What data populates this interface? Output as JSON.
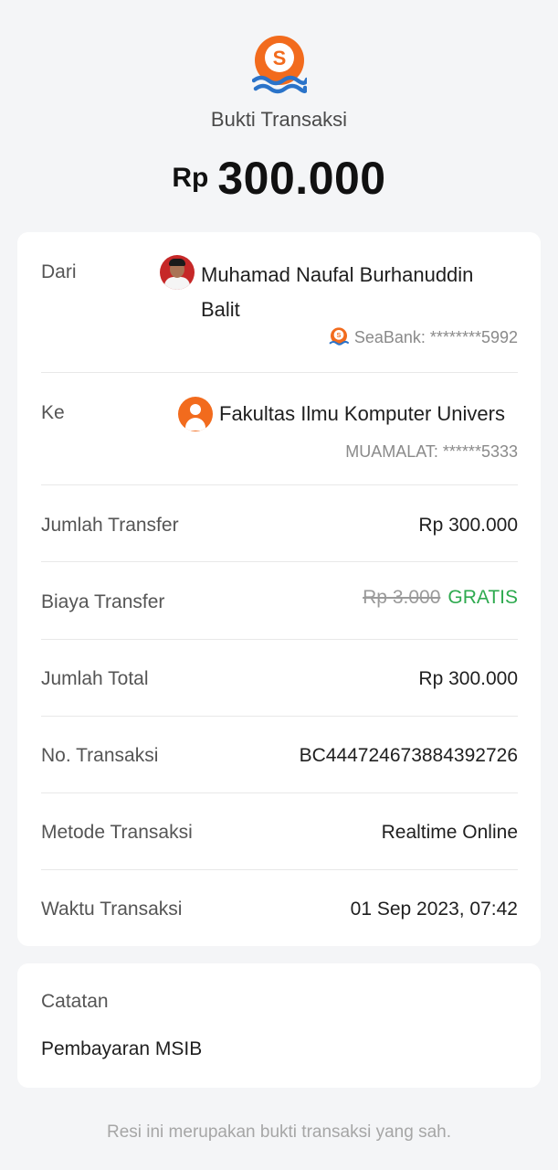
{
  "header": {
    "title": "Bukti Transaksi",
    "currency": "Rp",
    "amount": "300.000",
    "brand_color": "#f26b1d",
    "wave_color": "#2a73c9"
  },
  "sender": {
    "label": "Dari",
    "name": "Muhamad Naufal Burhanuddin Balit",
    "bank": "SeaBank: ********5992",
    "avatar_icon": "profile-photo"
  },
  "receiver": {
    "label": "Ke",
    "name": "Fakultas Ilmu Komputer Univers",
    "bank": "MUAMALAT: ******5333",
    "avatar_icon": "user-avatar-icon"
  },
  "details": {
    "jumlah_transfer": {
      "label": "Jumlah Transfer",
      "value": "Rp 300.000"
    },
    "biaya_transfer": {
      "label": "Biaya Transfer",
      "original": "Rp 3.000",
      "free_label": "GRATIS"
    },
    "jumlah_total": {
      "label": "Jumlah Total",
      "value": "Rp 300.000"
    },
    "no_transaksi": {
      "label": "No. Transaksi",
      "value": "BC444724673884392726"
    },
    "metode": {
      "label": "Metode Transaksi",
      "value": "Realtime Online"
    },
    "waktu": {
      "label": "Waktu Transaksi",
      "value": "01 Sep 2023, 07:42"
    }
  },
  "note": {
    "label": "Catatan",
    "value": "Pembayaran MSIB"
  },
  "footer": {
    "text": "Resi ini merupakan bukti transaksi yang sah."
  },
  "colors": {
    "success": "#2eaa4f",
    "background": "#f4f5f7"
  }
}
